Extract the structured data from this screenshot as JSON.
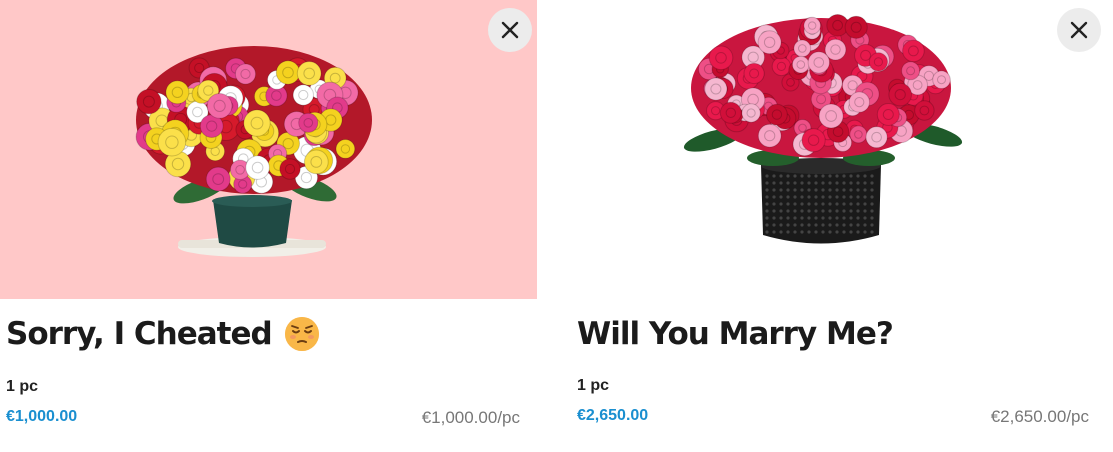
{
  "products": [
    {
      "title": "Sorry, I Cheated",
      "emoji": "pensive-face-emoji",
      "image": "mixed-color-roses-bouquet-in-pot",
      "image_bg": "#ffc8c8",
      "quantity": "1 pc",
      "price": "€1,000.00",
      "unit_price": "€1,000.00/pc",
      "close_icon": "close-icon"
    },
    {
      "title": "Will You Marry Me?",
      "image": "red-pink-roses-in-black-pot",
      "image_bg": "#ffffff",
      "quantity": "1 pc",
      "price": "€2,650.00",
      "unit_price": "€2,650.00/pc",
      "close_icon": "close-icon"
    }
  ],
  "colors": {
    "price_accent": "#1a8fd0",
    "unit_price": "#777777",
    "title": "#1b1b1b",
    "close_bg": "#ececec"
  }
}
